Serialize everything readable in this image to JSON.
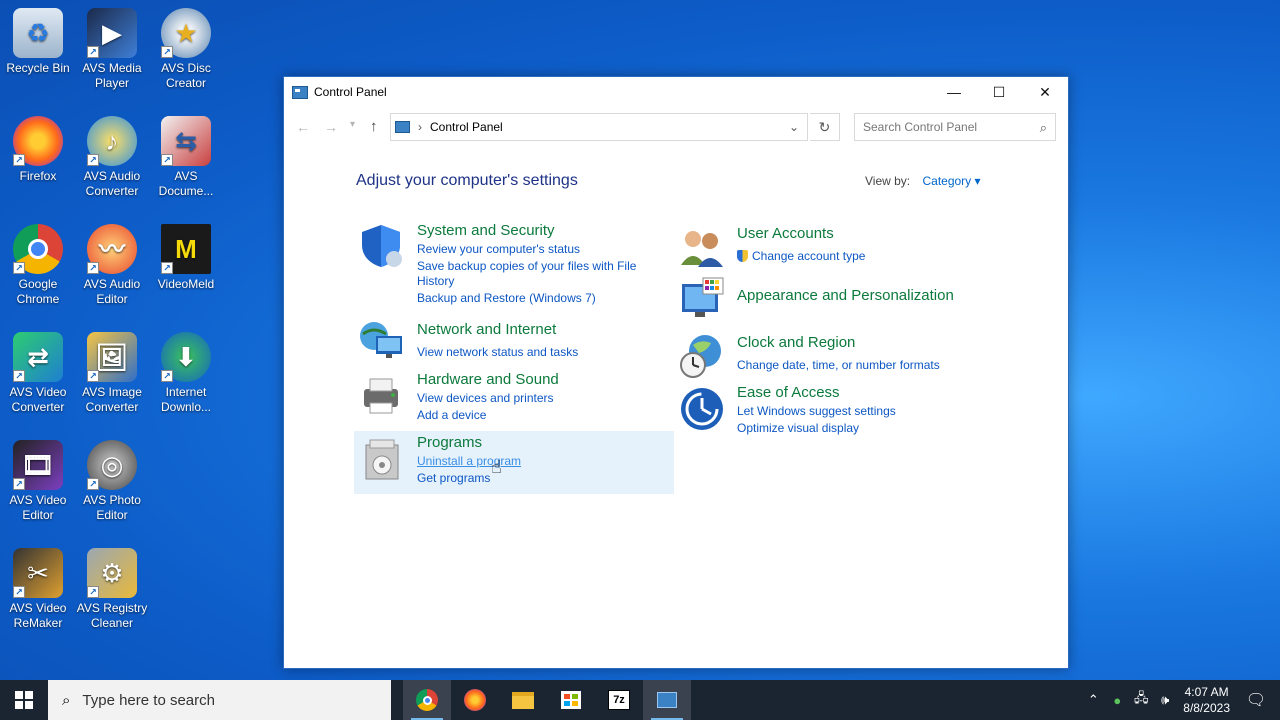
{
  "desktop": {
    "icons": [
      {
        "label": "Recycle Bin"
      },
      {
        "label": "AVS Media Player"
      },
      {
        "label": "AVS Disc Creator"
      },
      {
        "label": "Firefox"
      },
      {
        "label": "AVS Audio Converter"
      },
      {
        "label": "AVS Docume..."
      },
      {
        "label": "Google Chrome"
      },
      {
        "label": "AVS Audio Editor"
      },
      {
        "label": "VideoMeld"
      },
      {
        "label": "AVS Video Converter"
      },
      {
        "label": "AVS Image Converter"
      },
      {
        "label": "Internet Downlo..."
      },
      {
        "label": "AVS Video Editor"
      },
      {
        "label": "AVS Photo Editor"
      },
      {
        "label": "AVS Video ReMaker"
      },
      {
        "label": "AVS Registry Cleaner"
      }
    ]
  },
  "window": {
    "title": "Control Panel",
    "address": "Control Panel",
    "search_placeholder": "Search Control Panel",
    "heading": "Adjust your computer's settings",
    "view_by_label": "View by:",
    "view_by_value": "Category",
    "categories": {
      "system": {
        "title": "System and Security",
        "links": [
          "Review your computer's status",
          "Save backup copies of your files with File",
          "History",
          "Backup and Restore (Windows 7)"
        ]
      },
      "network": {
        "title": "Network and Internet",
        "links": [
          "View network status and tasks"
        ]
      },
      "hardware": {
        "title": "Hardware and Sound",
        "links": [
          "View devices and printers",
          "Add a device"
        ]
      },
      "programs": {
        "title": "Programs",
        "links": [
          "Uninstall a program",
          "Get programs"
        ]
      },
      "users": {
        "title": "User Accounts",
        "links": [
          "Change account type"
        ]
      },
      "appearance": {
        "title": "Appearance and Personalization",
        "links": []
      },
      "clock": {
        "title": "Clock and Region",
        "links": [
          "Change date, time, or number formats"
        ]
      },
      "ease": {
        "title": "Ease of Access",
        "links": [
          "Let Windows suggest settings",
          "Optimize visual display"
        ]
      }
    }
  },
  "taskbar": {
    "search_placeholder": "Type here to search",
    "time": "4:07 AM",
    "date": "8/8/2023",
    "apps": [
      "chrome-icon",
      "firefox-icon",
      "file-explorer-icon",
      "store-icon",
      "7zip-icon",
      "control-panel-icon"
    ]
  },
  "colors": {
    "category_title": "#0c7a3c",
    "link": "#0d57c4",
    "heading": "#1e3287",
    "taskbar": "#1b2531"
  }
}
